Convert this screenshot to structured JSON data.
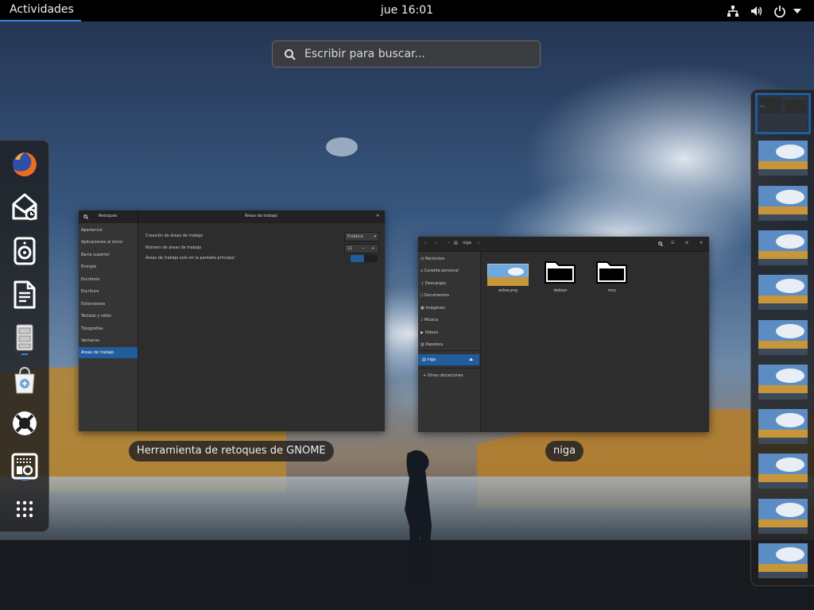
{
  "topbar": {
    "activities_label": "Actividades",
    "clock": "jue 16:01",
    "tray_icons": [
      "network-icon",
      "volume-icon",
      "power-icon",
      "arrow-down-icon"
    ]
  },
  "search": {
    "placeholder": "Escribir para buscar..."
  },
  "dash": {
    "apps": [
      {
        "name": "firefox",
        "running": false
      },
      {
        "name": "evolution",
        "running": false
      },
      {
        "name": "rhythmbox",
        "running": false
      },
      {
        "name": "libreoffice-writer",
        "running": false
      },
      {
        "name": "files",
        "running": true
      },
      {
        "name": "software",
        "running": false
      },
      {
        "name": "help",
        "running": false
      },
      {
        "name": "tweaks",
        "running": true
      },
      {
        "name": "show-applications",
        "running": false
      }
    ]
  },
  "windows": {
    "tweaks": {
      "caption": "Herramienta de retoques de GNOME",
      "sidebar_title": "Retoques",
      "panel_title": "Áreas de trabajo",
      "sidebar": [
        "Apariencia",
        "Aplicaciones al inicio",
        "Barra superior",
        "Energía",
        "Escritorio",
        "Escritura",
        "Extensiones",
        "Teclado y ratón",
        "Tipografías",
        "Ventanas",
        "Áreas de trabajo"
      ],
      "settings": [
        {
          "label": "Creación de áreas de trabajo",
          "value": "Estático"
        },
        {
          "label": "Número de áreas de trabajo",
          "value": "11"
        },
        {
          "label": "Áreas de trabajo solo en la pantalla principal",
          "value": ""
        }
      ]
    },
    "nautilus": {
      "caption": "niga",
      "path": "niga",
      "sidebar": [
        "Recientes",
        "Carpeta personal",
        "Descargas",
        "Documentos",
        "Imágenes",
        "Música",
        "Vídeos",
        "Papelera",
        "niga",
        "Otras ubicaciones"
      ],
      "files": [
        {
          "name": "anbw.png",
          "kind": "image"
        },
        {
          "name": "debian",
          "kind": "folder"
        },
        {
          "name": "moc",
          "kind": "folder"
        }
      ]
    }
  },
  "workspaces": {
    "count": 11,
    "active_index": 0
  },
  "colors": {
    "accent": "#3584e4",
    "selection": "#215d9c",
    "topbar": "#000000"
  }
}
